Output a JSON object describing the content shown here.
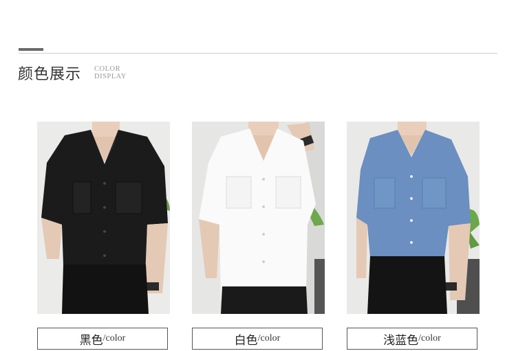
{
  "section": {
    "title": "颜色展示",
    "subtitle_line1": "COLOR",
    "subtitle_line2": "DISPLAY"
  },
  "products": [
    {
      "color_name": "黑色",
      "color_suffix": "/color",
      "swatch": "#1a1a1a",
      "photo_alt": "black short-sleeve shirt"
    },
    {
      "color_name": "白色",
      "color_suffix": "/color",
      "swatch": "#f6f6f6",
      "photo_alt": "white short-sleeve shirt"
    },
    {
      "color_name": "浅蓝色",
      "color_suffix": "/color",
      "swatch": "#6a8fc0",
      "photo_alt": "light blue short-sleeve shirt"
    }
  ]
}
